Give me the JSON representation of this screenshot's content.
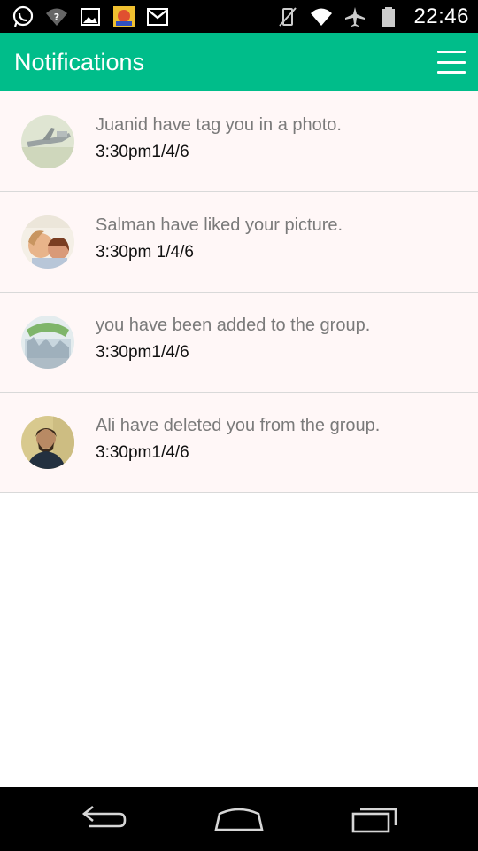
{
  "status_bar": {
    "time": "22:46",
    "left_icons": [
      "whatsapp-icon",
      "wifi-question-icon",
      "gallery-icon",
      "app-thumbnail-icon",
      "gmail-icon"
    ],
    "right_icons": [
      "vibrate-off-icon",
      "wifi-icon",
      "airplane-icon",
      "battery-icon"
    ]
  },
  "app_bar": {
    "title": "Notifications",
    "background_color": "#00bd8a"
  },
  "notifications": [
    {
      "message": "Juanid have tag you in a photo.",
      "time": "3:30pm1/4/6",
      "avatar": "airplane-photo"
    },
    {
      "message": "Salman have liked your picture.",
      "time": "3:30pm 1/4/6",
      "avatar": "children-photo"
    },
    {
      "message": "you have been added to the group.",
      "time": "3:30pm1/4/6",
      "avatar": "album-cover-photo"
    },
    {
      "message": "Ali have deleted you from the group.",
      "time": "3:30pm1/4/6",
      "avatar": "man-portrait-photo"
    }
  ],
  "nav_bar": {
    "buttons": [
      "back-icon",
      "home-icon",
      "recent-apps-icon"
    ]
  }
}
